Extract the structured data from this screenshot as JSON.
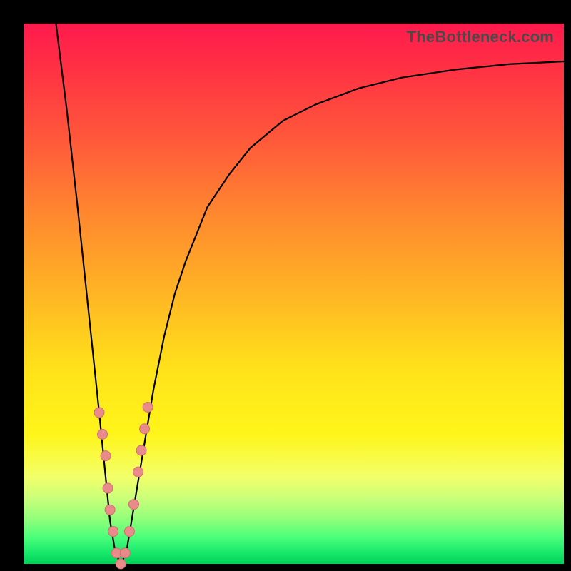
{
  "watermark": "TheBottleneck.com",
  "colors": {
    "gradient_top": "#ff1a4d",
    "gradient_bottom": "#00d158",
    "curve": "#000000",
    "dots_fill": "#e98b8b",
    "dots_stroke": "#d16e6e",
    "frame": "#000000"
  },
  "chart_data": {
    "type": "line",
    "title": "",
    "xlabel": "",
    "ylabel": "",
    "xlim": [
      0,
      100
    ],
    "ylim": [
      0,
      100
    ],
    "grid": false,
    "legend": false,
    "series": [
      {
        "name": "bottleneck-curve",
        "x": [
          6,
          8,
          10,
          12,
          14,
          15,
          16,
          17,
          18,
          19,
          20,
          22,
          24,
          26,
          28,
          30,
          34,
          38,
          42,
          48,
          54,
          62,
          70,
          80,
          90,
          100
        ],
        "y": [
          100,
          84,
          66,
          47,
          28,
          18,
          8,
          2,
          0,
          2,
          8,
          20,
          32,
          42,
          50,
          56,
          66,
          72,
          77,
          82,
          85,
          88,
          90,
          91.5,
          92.5,
          93
        ]
      }
    ],
    "annotations": {
      "dots_cluster": {
        "description": "pink marker cluster near the curve minimum",
        "points": [
          {
            "x": 14.0,
            "y": 28
          },
          {
            "x": 14.6,
            "y": 24
          },
          {
            "x": 15.2,
            "y": 20
          },
          {
            "x": 15.6,
            "y": 14
          },
          {
            "x": 16.0,
            "y": 10
          },
          {
            "x": 16.6,
            "y": 6
          },
          {
            "x": 17.2,
            "y": 2
          },
          {
            "x": 18.0,
            "y": 0
          },
          {
            "x": 18.8,
            "y": 2
          },
          {
            "x": 19.6,
            "y": 6
          },
          {
            "x": 20.4,
            "y": 11
          },
          {
            "x": 21.2,
            "y": 17
          },
          {
            "x": 21.8,
            "y": 21
          },
          {
            "x": 22.4,
            "y": 25
          },
          {
            "x": 23.0,
            "y": 29
          }
        ]
      }
    }
  }
}
